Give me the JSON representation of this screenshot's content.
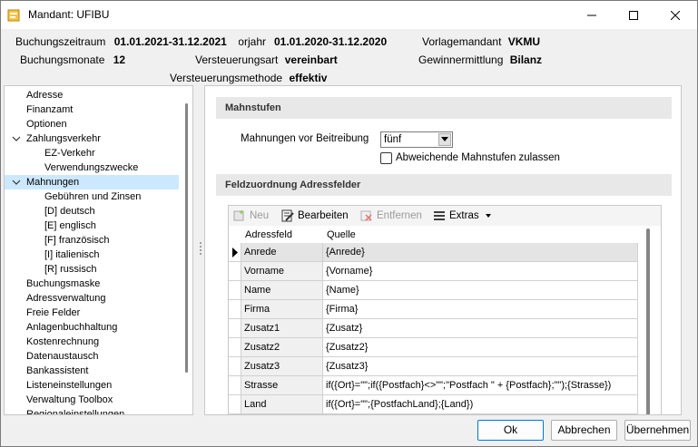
{
  "window": {
    "title": "Mandant: UFIBU"
  },
  "header": {
    "buchungszeitraum_label": "Buchungszeitraum",
    "buchungszeitraum_value": "01.01.2021-31.12.2021",
    "vorjahr_label": "Vorjahr",
    "vorjahr_value": "01.01.2020-31.12.2020",
    "vorlagemandant_label": "Vorlagemandant",
    "vorlagemandant_value": "VKMU",
    "buchungsmonate_label": "Buchungsmonate",
    "buchungsmonate_value": "12",
    "versteuerungsart_label": "Versteuerungsart",
    "versteuerungsart_value": "vereinbart",
    "gewinnermittlung_label": "Gewinnermittlung",
    "gewinnermittlung_value": "Bilanz",
    "versteuerungsmethode_label": "Versteuerungsmethode",
    "versteuerungsmethode_value": "effektiv"
  },
  "tree": {
    "items": [
      {
        "label": "Adresse"
      },
      {
        "label": "Finanzamt"
      },
      {
        "label": "Optionen"
      },
      {
        "label": "Zahlungsverkehr"
      },
      {
        "label": "EZ-Verkehr"
      },
      {
        "label": "Verwendungszwecke"
      },
      {
        "label": "Mahnungen"
      },
      {
        "label": "Gebühren und Zinsen"
      },
      {
        "label": "[D]  deutsch"
      },
      {
        "label": "[E]  englisch"
      },
      {
        "label": "[F]  französisch"
      },
      {
        "label": "[I]  italienisch"
      },
      {
        "label": "[R]  russisch"
      },
      {
        "label": "Buchungsmaske"
      },
      {
        "label": "Adressverwaltung"
      },
      {
        "label": "Freie Felder"
      },
      {
        "label": "Anlagenbuchhaltung"
      },
      {
        "label": "Kostenrechnung"
      },
      {
        "label": "Datenaustausch"
      },
      {
        "label": "Bankassistent"
      },
      {
        "label": "Listeneinstellungen"
      },
      {
        "label": "Verwaltung Toolbox"
      },
      {
        "label": "Regionaleinstellungen"
      }
    ]
  },
  "mahnstufen": {
    "title": "Mahnstufen",
    "vor_beitreibung_label": "Mahnungen vor Beitreibung",
    "vor_beitreibung_value": "fünf",
    "abweichende_label": "Abweichende Mahnstufen zulassen"
  },
  "feldzuordnung": {
    "title": "Feldzuordnung Adressfelder",
    "toolbar": {
      "neu": "Neu",
      "bearbeiten": "Bearbeiten",
      "entfernen": "Entfernen",
      "extras": "Extras"
    },
    "columns": [
      "Adressfeld",
      "Quelle"
    ],
    "rows": [
      {
        "field": "Anrede",
        "source": "{Anrede}"
      },
      {
        "field": "Vorname",
        "source": "{Vorname}"
      },
      {
        "field": "Name",
        "source": "{Name}"
      },
      {
        "field": "Firma",
        "source": "{Firma}"
      },
      {
        "field": "Zusatz1",
        "source": "{Zusatz}"
      },
      {
        "field": "Zusatz2",
        "source": "{Zusatz2}"
      },
      {
        "field": "Zusatz3",
        "source": "{Zusatz3}"
      },
      {
        "field": "Strasse",
        "source": "if({Ort}=\"\";if({Postfach}<>\"\";\"Postfach \" + {Postfach};\"\");{Strasse})"
      },
      {
        "field": "Land",
        "source": "if({Ort}=\"\";{PostfachLand};{Land})"
      }
    ]
  },
  "buttons": {
    "ok": "Ok",
    "abbrechen": "Abbrechen",
    "uebernehmen": "Übernehmen"
  },
  "colors": {
    "selection": "#cce8ff",
    "section_header": "#e8e8e8",
    "accent": "#0078d7"
  }
}
